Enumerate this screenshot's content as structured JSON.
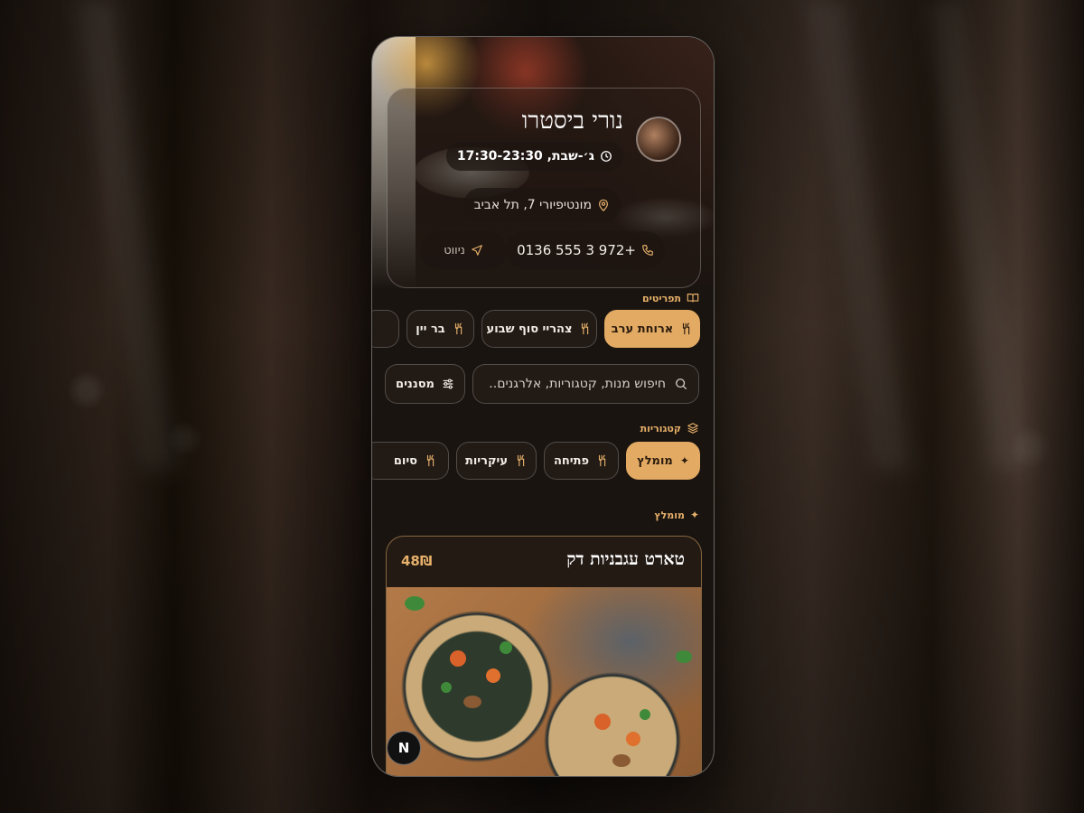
{
  "restaurant": {
    "name": "נורי ביסטרו",
    "hours": "ג׳-שבת, 17:30-23:30",
    "address": "מונטיפיורי 7, תל אביב",
    "phone": "+972 3 555 0136",
    "navigate_label": "ניווט"
  },
  "menus": {
    "label": "תפריטים",
    "items": [
      {
        "label": "ארוחת ערב",
        "active": true
      },
      {
        "label": "צהריי סוף שבוע",
        "active": false
      },
      {
        "label": "בר יין",
        "active": false
      }
    ]
  },
  "search": {
    "placeholder": "חיפוש מנות, קטגוריות, אלרגנים..",
    "filters_label": "מסננים"
  },
  "categories": {
    "label": "קטגוריות",
    "items": [
      {
        "label": "מומלץ",
        "active": true
      },
      {
        "label": "פתיחה",
        "active": false
      },
      {
        "label": "עיקריות",
        "active": false
      },
      {
        "label": "סיום",
        "active": false
      }
    ]
  },
  "recommended": {
    "label": "מומלץ",
    "dish": {
      "name": "טארט עגבניות דק",
      "price": "48₪"
    }
  },
  "badge": {
    "label": "N"
  },
  "colors": {
    "accent": "#e2aa63",
    "background": "#1a1410",
    "text": "#ffffff"
  },
  "icons": [
    "clock-icon",
    "pin-icon",
    "phone-icon",
    "navigation-icon",
    "book-icon",
    "utensils-icon",
    "search-icon",
    "sliders-icon",
    "layers-icon",
    "sparkle-icon"
  ]
}
